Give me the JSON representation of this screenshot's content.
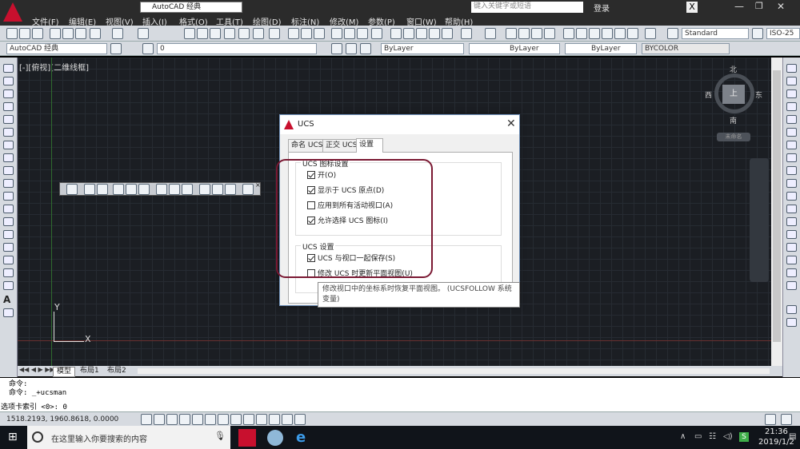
{
  "app": {
    "title_combo": "AutoCAD 经典",
    "search_placeholder": "键入关键字或短语",
    "login": "登录"
  },
  "menus": [
    "文件(F)",
    "编辑(E)",
    "视图(V)",
    "插入(I)",
    "格式(O)",
    "工具(T)",
    "绘图(D)",
    "标注(N)",
    "修改(M)",
    "参数(P)",
    "窗口(W)",
    "帮助(H)"
  ],
  "toolbar": {
    "workspace": "AutoCAD 经典",
    "layer_value": "0",
    "color": "ByLayer",
    "linetype": "ByLayer",
    "lineweight": "ByLayer",
    "plotstyle": "BYCOLOR",
    "style_value": "Standard",
    "iso": "ISO-25"
  },
  "viewport": {
    "label": "[-][俯视][二维线框]",
    "ucs_y": "Y",
    "ucs_x": "X"
  },
  "viewcube": {
    "north": "北",
    "south": "南",
    "east": "东",
    "west": "西",
    "face": "上",
    "unnamed": "未命名"
  },
  "layout_tabs": [
    "模型",
    "布局1",
    "布局2"
  ],
  "dialog": {
    "title": "UCS",
    "tabs": [
      "命名 UCS",
      "正交 UCS",
      "设置"
    ],
    "group1_title": "UCS 图标设置",
    "group1_items": [
      {
        "label": "开(O)",
        "checked": true
      },
      {
        "label": "显示于 UCS 原点(D)",
        "checked": true
      },
      {
        "label": "应用到所有活动视口(A)",
        "checked": false
      },
      {
        "label": "允许选择 UCS 图标(I)",
        "checked": true
      }
    ],
    "group2_title": "UCS 设置",
    "group2_items": [
      {
        "label": "UCS 与视口一起保存(S)",
        "checked": true
      },
      {
        "label": "修改 UCS 时更新平面视图(U)",
        "checked": false
      }
    ],
    "tooltip": "修改视口中的坐标系时恢复平面视图。 (UCSFOLLOW 系统变量)"
  },
  "command": {
    "line1": "命令:",
    "line2": "命令: _+ucsman",
    "line3": "选项卡索引 <0>: 0"
  },
  "status": {
    "coords": "1518.2193,  1960.8618,  0.0000"
  },
  "taskbar": {
    "search_text": "在这里输入你要搜索的内容",
    "time": "21:36",
    "date": "2019/1/2"
  }
}
